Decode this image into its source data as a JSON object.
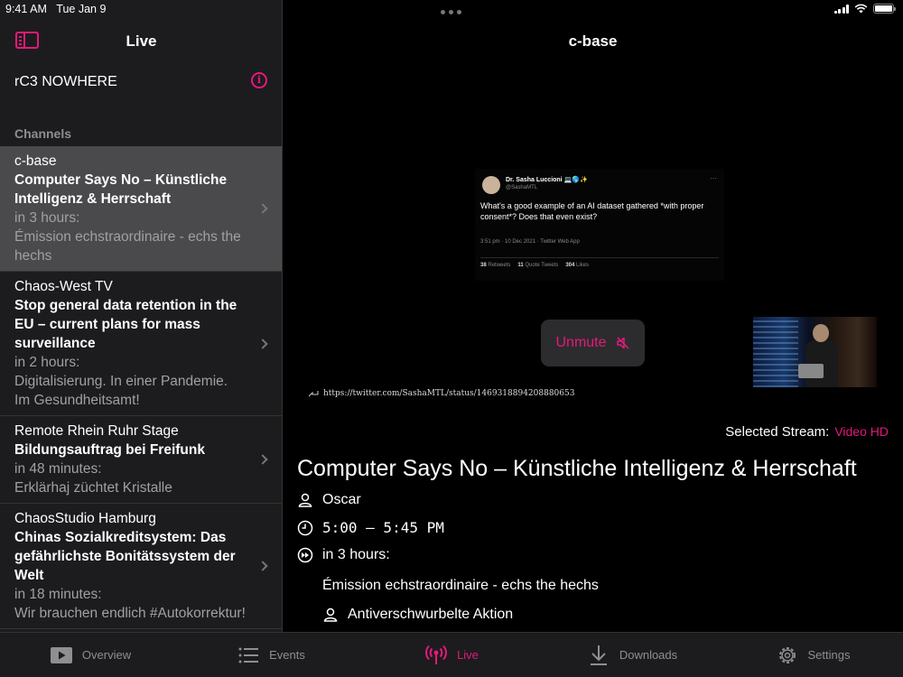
{
  "status": {
    "time": "9:41 AM",
    "date": "Tue Jan 9",
    "battery_percent": 100
  },
  "sidebar": {
    "title": "Live",
    "conference": "rC3 NOWHERE",
    "section_label": "Channels",
    "channels": [
      {
        "name": "c-base",
        "title": "Computer Says No – Künstliche Intelligenz & Herrschaft",
        "time": "in 3 hours:",
        "next": "Émission echstraordinaire - echs the hechs"
      },
      {
        "name": "Chaos-West TV",
        "title": "Stop general data retention in the EU – current plans for mass surveillance",
        "time": "in 2 hours:",
        "next": "Digitalisierung. In einer Pandemie. Im Gesundheitsamt!"
      },
      {
        "name": "Remote Rhein Ruhr Stage",
        "title": "Bildungsauftrag bei Freifunk",
        "time": "in 48 minutes:",
        "next": "Erklärhaj züchtet Kristalle"
      },
      {
        "name": "ChaosStudio Hamburg",
        "title": "Chinas Sozialkreditsystem: Das gefährlichste Bonitätssystem der Welt",
        "time": "in 18 minutes:",
        "next": "Wir brauchen endlich #Autokorrektur!"
      }
    ]
  },
  "main": {
    "title": "c-base",
    "video": {
      "tweet": {
        "author": "Dr. Sasha Luccioni 💻🌎✨",
        "handle": "@SashaMTL",
        "more": "···",
        "text": "What's a good example of an AI dataset gathered *with proper consent*? Does that even exist?",
        "meta": "3:51 pm · 10 Dec 2021 · Twitter Web App",
        "retweets": "38",
        "retweets_label": "Retweets",
        "quotes": "11",
        "quotes_label": "Quote Tweets",
        "likes": "304",
        "likes_label": "Likes"
      },
      "unmute_label": "Unmute",
      "url": "https://twitter.com/SashaMTL/status/1469318894208880653"
    },
    "selected_stream_label": "Selected Stream:",
    "selected_stream_value": "Video HD",
    "event": {
      "title": "Computer Says No – Künstliche Intelligenz & Herrschaft",
      "speaker": "Oscar",
      "time": "5:00 – 5:45 PM",
      "next_label": "in 3 hours:",
      "next_title": "Émission echstraordinaire - echs the hechs",
      "next_speaker": "Antiverschwurbelte Aktion"
    }
  },
  "tabs": [
    {
      "label": "Overview",
      "icon": "play-icon"
    },
    {
      "label": "Events",
      "icon": "list-icon"
    },
    {
      "label": "Live",
      "icon": "broadcast-icon",
      "active": true
    },
    {
      "label": "Downloads",
      "icon": "download-icon"
    },
    {
      "label": "Settings",
      "icon": "gear-icon"
    }
  ],
  "colors": {
    "accent": "#e5197a",
    "sidebar_bg": "#1c1c1e",
    "selected_row": "#4a4a4c"
  }
}
